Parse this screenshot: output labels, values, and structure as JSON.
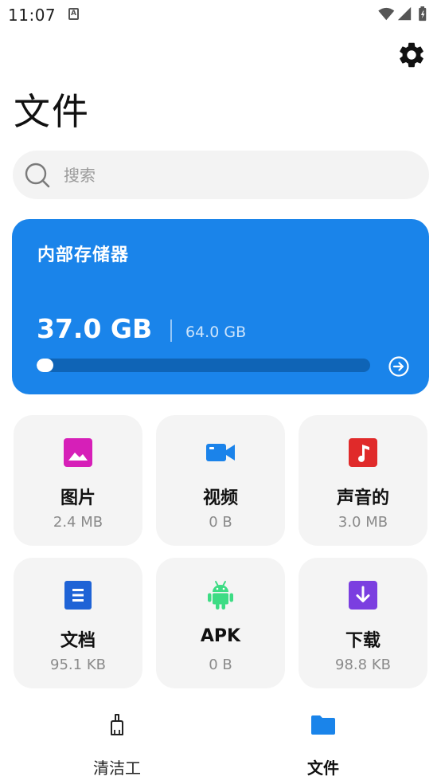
{
  "status_bar": {
    "time": "11:07",
    "notification_letter": "A"
  },
  "header": {
    "title": "文件"
  },
  "search": {
    "placeholder": "搜索",
    "value": ""
  },
  "storage": {
    "title": "内部存储器",
    "used": "37.0 GB",
    "total": "64.0 GB",
    "usage_fraction": 0.02
  },
  "categories": [
    {
      "label": "图片",
      "size": "2.4 MB",
      "icon": "image-icon",
      "color": "#d61fb8"
    },
    {
      "label": "视频",
      "size": "0 B",
      "icon": "video-camera-icon",
      "color": "#1b83ea"
    },
    {
      "label": "声音的",
      "size": "3.0 MB",
      "icon": "music-note-icon",
      "color": "#e02a2a"
    },
    {
      "label": "文档",
      "size": "95.1 KB",
      "icon": "document-icon",
      "color": "#1f63d6"
    },
    {
      "label": "APK",
      "size": "0 B",
      "icon": "android-icon",
      "color": "#3ddc84"
    },
    {
      "label": "下载",
      "size": "98.8 KB",
      "icon": "download-icon",
      "color": "#7b3ee0"
    }
  ],
  "bottom_nav": [
    {
      "label": "清洁工",
      "icon": "broom-icon",
      "active": false
    },
    {
      "label": "文件",
      "icon": "folder-icon",
      "active": true
    }
  ],
  "colors": {
    "accent": "#1a84ea",
    "tile_bg": "#f4f4f4",
    "search_bg": "#f3f3f3"
  }
}
